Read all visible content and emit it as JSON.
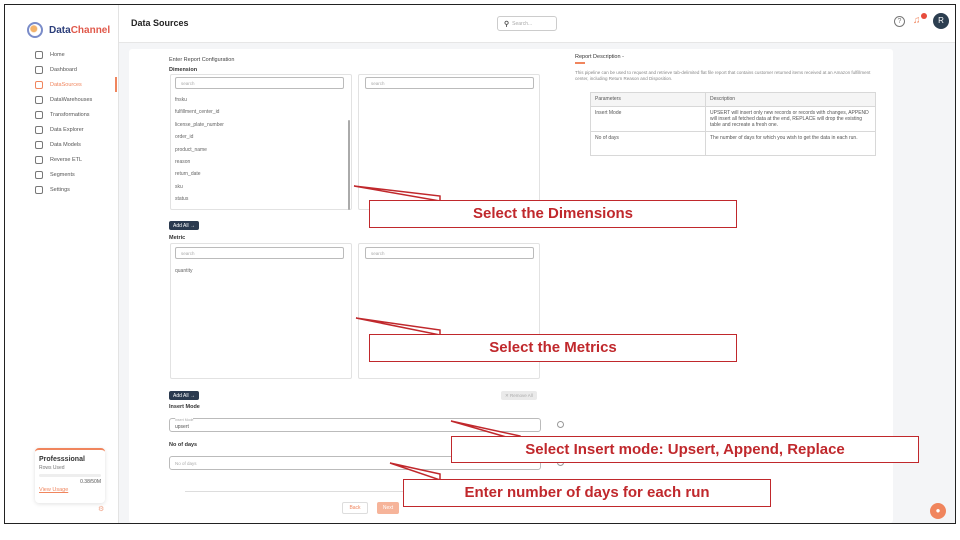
{
  "app": {
    "brand_prefix": "Data",
    "brand_suffix": "Channel",
    "page_title": "Data Sources",
    "search_placeholder": "Search...",
    "avatar_initial": "R"
  },
  "sidebar": {
    "items": [
      {
        "label": "Home",
        "icon": "home-icon"
      },
      {
        "label": "Dashboard",
        "icon": "dashboard-icon"
      },
      {
        "label": "DataSources",
        "icon": "datasources-icon",
        "active": true
      },
      {
        "label": "DataWarehouses",
        "icon": "database-icon"
      },
      {
        "label": "Transformations",
        "icon": "transform-icon"
      },
      {
        "label": "Data Explorer",
        "icon": "explorer-icon"
      },
      {
        "label": "Data Models",
        "icon": "models-icon"
      },
      {
        "label": "Reverse ETL",
        "icon": "reverse-etl-icon"
      },
      {
        "label": "Segments",
        "icon": "segments-icon"
      },
      {
        "label": "Settings",
        "icon": "gear-icon"
      }
    ],
    "plan": {
      "title": "Professsional",
      "rows_used_label": "Rows Used",
      "rows_used_value": "0.38/50M",
      "view_usage": "View Usage"
    }
  },
  "form": {
    "section_title": "Enter Report Configuration",
    "dimension_label": "Dimension",
    "search_placeholder": "search",
    "dimensions": [
      "fnsku",
      "fulfillment_center_id",
      "license_plate_number",
      "order_id",
      "product_name",
      "reason",
      "return_date",
      "sku",
      "status"
    ],
    "add_all": "Add All →",
    "metric_label": "Metric",
    "metrics": [
      "quantity"
    ],
    "remove_all": "✕ Remove All",
    "insert_mode_label": "Insert Mode",
    "insert_mode_float": "Insert Mode",
    "insert_mode_value": "upsert",
    "days_label": "No of days",
    "days_placeholder": "No of days",
    "back": "Back",
    "next": "Next"
  },
  "description": {
    "title": "Report Description -",
    "text": "This pipeline can be used to request and retrieve tab-delimited flat file report that contains customer returned items received at an Amazon fulfillment center, including Return Reason and Disposition.",
    "table_headers": [
      "Parameters",
      "Description"
    ],
    "table_rows": [
      [
        "Insert Mode",
        "UPSERT will insert only new records or records with changes, APPEND will insert all fetched data at the end, REPLACE will drop the existing table and recreate a fresh one."
      ],
      [
        "No of days",
        "The number of days for which you wish to get the data in each run."
      ]
    ]
  },
  "callouts": {
    "dimensions": "Select the Dimensions",
    "metrics": "Select the Metrics",
    "insert_mode": "Select Insert mode: Upsert, Append, Replace",
    "days": "Enter number of days for each run"
  },
  "colors": {
    "accent": "#f0855d",
    "callout": "#c0282c",
    "dark_button": "#2b3a4f"
  }
}
